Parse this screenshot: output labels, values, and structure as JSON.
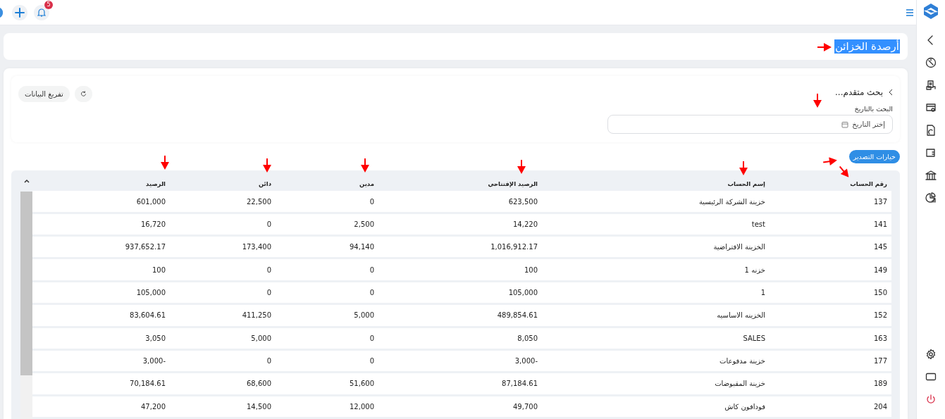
{
  "header": {
    "notification_count": "5"
  },
  "page_title": {
    "text": "أرصدة الخزائن",
    "text_selected": true
  },
  "search_panel": {
    "toggle_label": "بحث متقدم...",
    "date_filter": {
      "label": "البحث بالتاريخ",
      "placeholder": "إختر التاريخ"
    },
    "buttons": [
      {
        "kind": "refresh"
      },
      {
        "kind": "text",
        "label": "تفريغ البيانات"
      }
    ]
  },
  "export_button": {
    "label": "خيارات التصدير"
  },
  "table": {
    "columns": [
      "رقم الحساب",
      "إسم الحساب",
      "الرصيد الإفتتاحي",
      "مدين",
      "دائن",
      "الرصيد"
    ],
    "rows": [
      [
        "137",
        "خزينة الشركة الرئيسية",
        "623,500",
        "0",
        "22,500",
        "601,000"
      ],
      [
        "141",
        "test",
        "14,220",
        "2,500",
        "0",
        "16,720"
      ],
      [
        "145",
        "الخزينة الافتراضية",
        "1,016,912.17",
        "94,140",
        "173,400",
        "937,652.17"
      ],
      [
        "149",
        "خزنه 1",
        "100",
        "0",
        "0",
        "100"
      ],
      [
        "150",
        "1",
        "105,000",
        "0",
        "0",
        "105,000"
      ],
      [
        "152",
        "الخزينه الاساسيه",
        "489,854.61",
        "5,000",
        "411,250",
        "83,604.61"
      ],
      [
        "163",
        "SALES",
        "8,050",
        "0",
        "5,000",
        "3,050"
      ],
      [
        "177",
        "خزينة مدفوعات",
        "-3,000",
        "0",
        "0",
        "-3,000"
      ],
      [
        "189",
        "خزينة المقبوضات",
        "87,184.61",
        "51,600",
        "68,600",
        "70,184.61"
      ],
      [
        "204",
        "فودافون كاش",
        "49,700",
        "12,000",
        "14,500",
        "47,200"
      ]
    ]
  }
}
